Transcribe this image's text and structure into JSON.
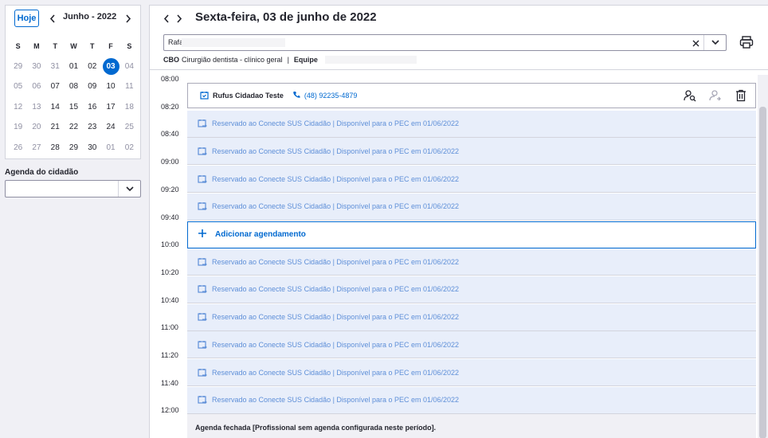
{
  "calendar": {
    "today_label": "Hoje",
    "month_label": "Junho - 2022",
    "weekdays": [
      "S",
      "M",
      "T",
      "W",
      "T",
      "F",
      "S"
    ],
    "weeks": [
      [
        {
          "d": "29",
          "m": true
        },
        {
          "d": "30",
          "m": true
        },
        {
          "d": "31",
          "m": true
        },
        {
          "d": "01"
        },
        {
          "d": "02"
        },
        {
          "d": "03",
          "sel": true
        },
        {
          "d": "04",
          "m": true
        }
      ],
      [
        {
          "d": "05",
          "m": true
        },
        {
          "d": "06",
          "m": true
        },
        {
          "d": "07"
        },
        {
          "d": "08"
        },
        {
          "d": "09"
        },
        {
          "d": "10"
        },
        {
          "d": "11",
          "m": true
        }
      ],
      [
        {
          "d": "12",
          "m": true
        },
        {
          "d": "13",
          "m": true
        },
        {
          "d": "14"
        },
        {
          "d": "15"
        },
        {
          "d": "16"
        },
        {
          "d": "17"
        },
        {
          "d": "18",
          "m": true
        }
      ],
      [
        {
          "d": "19",
          "m": true
        },
        {
          "d": "20",
          "m": true
        },
        {
          "d": "21"
        },
        {
          "d": "22"
        },
        {
          "d": "23"
        },
        {
          "d": "24"
        },
        {
          "d": "25",
          "m": true
        }
      ],
      [
        {
          "d": "26",
          "m": true
        },
        {
          "d": "27",
          "m": true
        },
        {
          "d": "28"
        },
        {
          "d": "29"
        },
        {
          "d": "30"
        },
        {
          "d": "01",
          "m": true
        },
        {
          "d": "02",
          "m": true
        }
      ]
    ]
  },
  "agenda": {
    "label": "Agenda do cidadão",
    "value": ""
  },
  "main": {
    "date_title": "Sexta-feira, 03 de junho de 2022",
    "search_value": "Rafa",
    "cbo_label": "CBO",
    "cbo_value": "Cirurgião dentista - clínico geral",
    "separator": "|",
    "equipe_label": "Equipe"
  },
  "schedule": {
    "times": [
      "08:00",
      "08:20",
      "08:40",
      "09:00",
      "09:20",
      "09:40",
      "10:00",
      "10:20",
      "10:40",
      "11:00",
      "11:20",
      "11:40",
      "12:00"
    ],
    "appointment": {
      "name": "Rufus Cidadao Teste",
      "phone": "(48) 92235-4879"
    },
    "reserved_text": "Reservado ao Conecte SUS Cidadão | Disponível para o PEC em 01/06/2022",
    "add_label": "Adicionar agendamento",
    "closed_text": "Agenda fechada [Profissional sem agenda configurada neste período]."
  },
  "colors": {
    "primary": "#0069d0",
    "slot_bg": "#e8eefa",
    "slot_text": "#5e8fd8"
  }
}
